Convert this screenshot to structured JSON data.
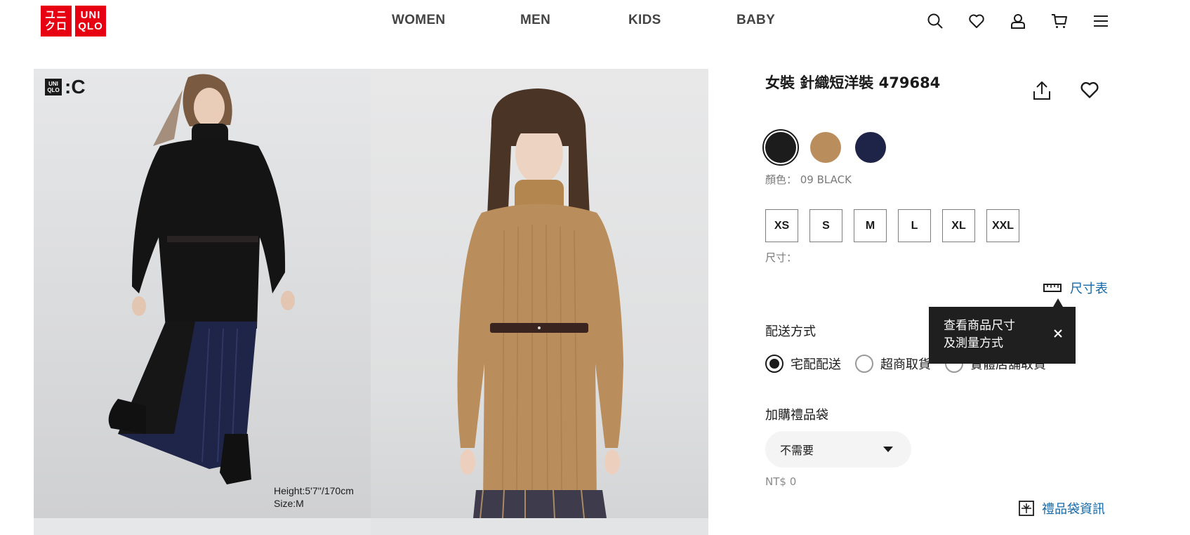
{
  "header": {
    "logo_line1": "ユニ",
    "logo_line2": "クロ",
    "logo_en_line1": "UNI",
    "logo_en_line2": "QLO",
    "nav": [
      "WOMEN",
      "MEN",
      "KIDS",
      "BABY"
    ],
    "icons": [
      "search-icon",
      "heart-icon",
      "account-icon",
      "cart-icon",
      "menu-icon"
    ]
  },
  "gallery": {
    "badge_text_top": "UNI",
    "badge_text_bottom": "QLO",
    "badge_suffix": ":C",
    "model_height": "Height:5'7''/170cm",
    "model_size": "Size:M"
  },
  "product": {
    "title": "女裝 針織短洋裝 479684",
    "colors": [
      {
        "name": "09 BLACK",
        "hex": "#1c1c1c",
        "selected": true
      },
      {
        "name": "camel",
        "hex": "#b98d5c",
        "selected": false
      },
      {
        "name": "navy",
        "hex": "#1e2447",
        "selected": false
      }
    ],
    "color_label": "顏色： 09 BLACK",
    "sizes": [
      "XS",
      "S",
      "M",
      "L",
      "XL",
      "XXL"
    ],
    "size_label": "尺寸：",
    "size_chart": "尺寸表",
    "tooltip_line1": "查看商品尺寸",
    "tooltip_line2": "及測量方式",
    "delivery_title": "配送方式",
    "delivery_options": [
      {
        "label": "宅配配送",
        "checked": true
      },
      {
        "label": "超商取貨",
        "checked": false
      },
      {
        "label": "實體店舖取貨",
        "checked": false
      }
    ],
    "gift_bag_title": "加購禮品袋",
    "gift_bag_value": "不需要",
    "gift_bag_price": "NT$ 0",
    "gift_bag_info": "禮品袋資訊"
  },
  "colors": {
    "brand_red": "#e60012",
    "link_blue": "#1569a8"
  }
}
